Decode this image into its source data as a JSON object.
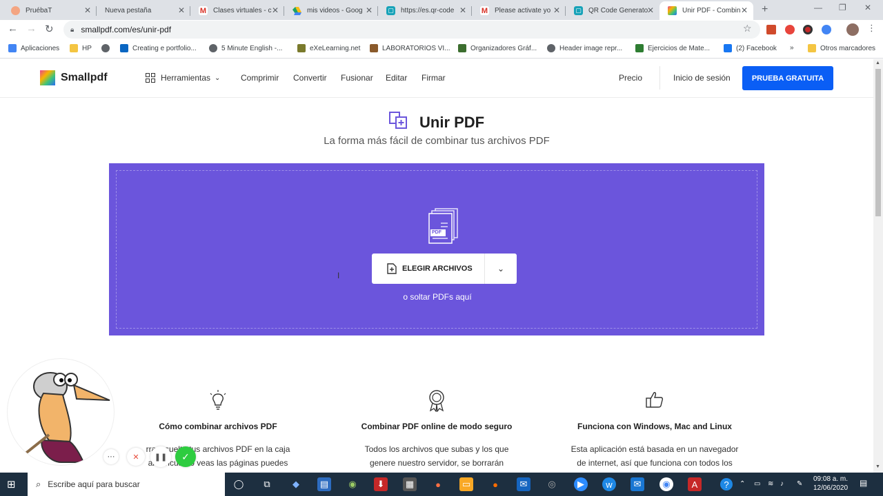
{
  "browser": {
    "tabs": [
      {
        "title": "PruébaT",
        "icon": "circle-logo-icon",
        "color": "#f4a582"
      },
      {
        "title": "Nueva pestaña",
        "icon": "",
        "color": ""
      },
      {
        "title": "Clases virtuales - c",
        "icon": "gmail-icon",
        "color": "#d93025"
      },
      {
        "title": "mis videos - Goog",
        "icon": "google-drive-icon",
        "color": "#1ea362"
      },
      {
        "title": "https://es.qr-code",
        "icon": "qr-code-icon",
        "color": "#17a2b8"
      },
      {
        "title": "Please activate yo",
        "icon": "gmail-icon",
        "color": "#d93025"
      },
      {
        "title": "QR Code Generato",
        "icon": "qr-code-icon",
        "color": "#17a2b8"
      },
      {
        "title": "Unir PDF - Combin",
        "icon": "smallpdf-icon",
        "color": "#e84393"
      }
    ],
    "url": "smallpdf.com/es/unir-pdf",
    "bookmarks": [
      {
        "label": "Aplicaciones",
        "color": "#4285f4"
      },
      {
        "label": "HP",
        "color": "#f4c542"
      },
      {
        "label": "",
        "color": "#5f6368"
      },
      {
        "label": "Creating e portfolio...",
        "color": "#0a66c2"
      },
      {
        "label": "5 Minute English -...",
        "color": "#5f6368"
      },
      {
        "label": "eXeLearning.net",
        "color": "#7a7a2c"
      },
      {
        "label": "LABORATORIOS VI...",
        "color": "#8a5a2b"
      },
      {
        "label": "Organizadores Gráf...",
        "color": "#3c6e2f"
      },
      {
        "label": "Header image repr...",
        "color": "#5f6368"
      },
      {
        "label": "Ejercicios de Mate...",
        "color": "#2e7d32"
      },
      {
        "label": "(2) Facebook",
        "color": "#1877f2"
      }
    ],
    "bookmarks_more": "»",
    "other_bookmarks": "Otros marcadores"
  },
  "site": {
    "logo_text": "Smallpdf",
    "nav": {
      "tools": "Herramientas",
      "compress": "Comprimir",
      "convert": "Convertir",
      "merge": "Fusionar",
      "edit": "Editar",
      "sign": "Firmar",
      "pricing": "Precio",
      "login": "Inicio de sesión",
      "trial": "PRUEBA GRATUITA"
    },
    "title": "Unir PDF",
    "subtitle": "La forma más fácil de combinar tus archivos PDF",
    "dropzone": {
      "choose_label": "ELEGIR ARCHIVOS",
      "hint": "o soltar PDFs aquí",
      "pdf_badge": "PDF",
      "color": "#6b55dc"
    },
    "features": [
      {
        "title": "Cómo combinar archivos PDF",
        "line1": "rra y suelta tus archivos PDF en la caja",
        "line2": "ar. Encuanto veas las páginas puedes"
      },
      {
        "title": "Combinar PDF online de modo seguro",
        "line1": "Todos los archivos que subas y los que",
        "line2": "genere nuestro servidor, se borrarán"
      },
      {
        "title": "Funciona con Windows, Mac and Linux",
        "line1": "Esta aplicación está basada en un navegador",
        "line2": "de internet, así que funciona con todos los"
      }
    ]
  },
  "taskbar": {
    "search_placeholder": "Escribe aquí para buscar",
    "time": "09:08 a. m.",
    "date": "12/06/2020"
  }
}
